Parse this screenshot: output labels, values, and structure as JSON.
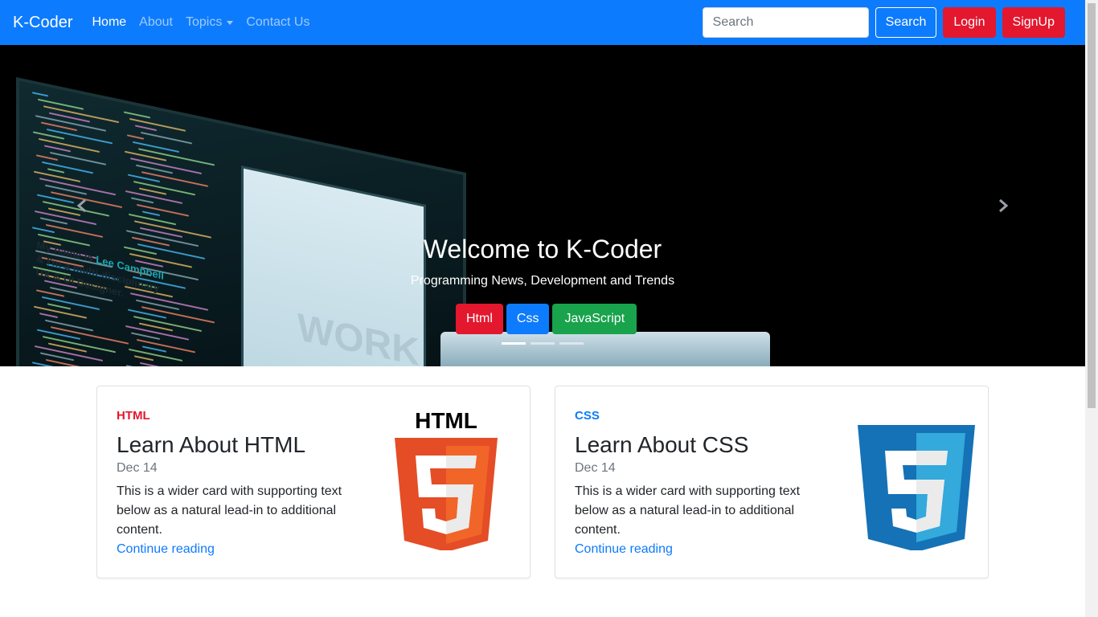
{
  "navbar": {
    "brand": "K-Coder",
    "links": [
      {
        "label": "Home",
        "active": true
      },
      {
        "label": "About",
        "active": false
      },
      {
        "label": "Topics",
        "active": false,
        "dropdown": true
      },
      {
        "label": "Contact Us",
        "active": false
      }
    ],
    "search_placeholder": "Search",
    "search_button": "Search",
    "login_button": "Login",
    "signup_button": "SignUp"
  },
  "carousel": {
    "title": "Welcome to K-Coder",
    "subtitle": "Programming News, Development and Trends",
    "buttons": [
      "Html",
      "Css",
      "JavaScript"
    ],
    "indicator_count": 3,
    "active_indicator": 0,
    "image_text": {
      "line1": "My name is",
      "highlight": "Lee Campbell",
      "line1_rest": "& I'm a multi-disciplinary UX & UI Designer.",
      "watermark": "WORK"
    }
  },
  "cards": [
    {
      "category": "HTML",
      "title": "Learn About HTML",
      "date": "Dec 14",
      "text": "This is a wider card with supporting text below as a natural lead-in to additional content.",
      "link": "Continue reading",
      "logo_text": "HTML"
    },
    {
      "category": "CSS",
      "title": "Learn About CSS",
      "date": "Dec 14",
      "text": "This is a wider card with supporting text below as a natural lead-in to additional content.",
      "link": "Continue reading"
    }
  ],
  "colors": {
    "primary": "#0d7bfd",
    "danger": "#e3172e",
    "success": "#18a34c",
    "html_orange": "#e44d26",
    "css_blue": "#1572b6"
  }
}
